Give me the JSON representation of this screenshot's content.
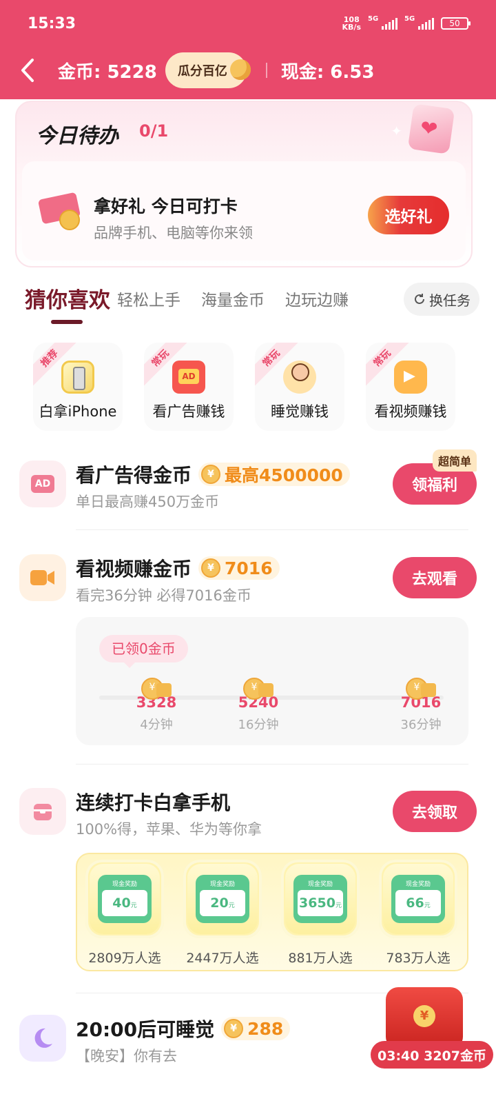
{
  "status_bar": {
    "time": "15:33",
    "net_speed_value": "108",
    "net_speed_unit": "KB/s",
    "sig1": "5G",
    "sig2": "5G",
    "battery": "50"
  },
  "top": {
    "coins_label": "金币: 5228",
    "pill_label": "瓜分百亿",
    "cash_label": "现金: 6.53"
  },
  "todo": {
    "title": "今日待办",
    "count": "0/1",
    "item_title": "拿好礼 今日可打卡",
    "item_sub": "品牌手机、电脑等你来领",
    "button": "选好礼"
  },
  "tabs": {
    "items": [
      "猜你喜欢",
      "轻松上手",
      "海量金币",
      "边玩边赚"
    ],
    "swap": "换任务"
  },
  "quick_cards": [
    {
      "tag": "推荐",
      "label": "白拿iPhone"
    },
    {
      "tag": "常玩",
      "label": "看广告赚钱"
    },
    {
      "tag": "常玩",
      "label": "睡觉赚钱"
    },
    {
      "tag": "常玩",
      "label": "看视频赚钱"
    }
  ],
  "tasks": {
    "ad": {
      "icon_text": "AD",
      "title": "看广告得金币",
      "reward": "最高4500000",
      "sub": "单日最高赚450万金币",
      "button": "领福利",
      "badge": "超简单"
    },
    "video": {
      "title": "看视频赚金币",
      "reward": "7016",
      "sub": "看完36分钟 必得7016金币",
      "button": "去观看",
      "progress_label": "已领0金币",
      "milestones": [
        {
          "value": "3328",
          "time": "4分钟"
        },
        {
          "value": "5240",
          "time": "16分钟"
        },
        {
          "value": "7016",
          "time": "36分钟"
        }
      ]
    },
    "checkin": {
      "title": "连续打卡白拿手机",
      "sub": "100%得，苹果、华为等你拿",
      "button": "去领取",
      "prizes": [
        {
          "label": "现金奖励",
          "amount": "40",
          "unit": "元",
          "count": "2809万人选"
        },
        {
          "label": "现金奖励",
          "amount": "20",
          "unit": "元",
          "count": "2447万人选"
        },
        {
          "label": "现金奖励",
          "amount": "3650",
          "unit": "元",
          "count": "881万人选"
        },
        {
          "label": "现金奖励",
          "amount": "66",
          "unit": "元",
          "count": "783万人选"
        }
      ]
    },
    "sleep": {
      "title": "20:00后可睡觉",
      "reward": "288",
      "sub": "【晚安】你有去"
    }
  },
  "floating": {
    "timer": "03:40 3207金币"
  },
  "colors": {
    "brand": "#e9496b",
    "reward": "#f08c1a",
    "green": "#5ac88f"
  }
}
